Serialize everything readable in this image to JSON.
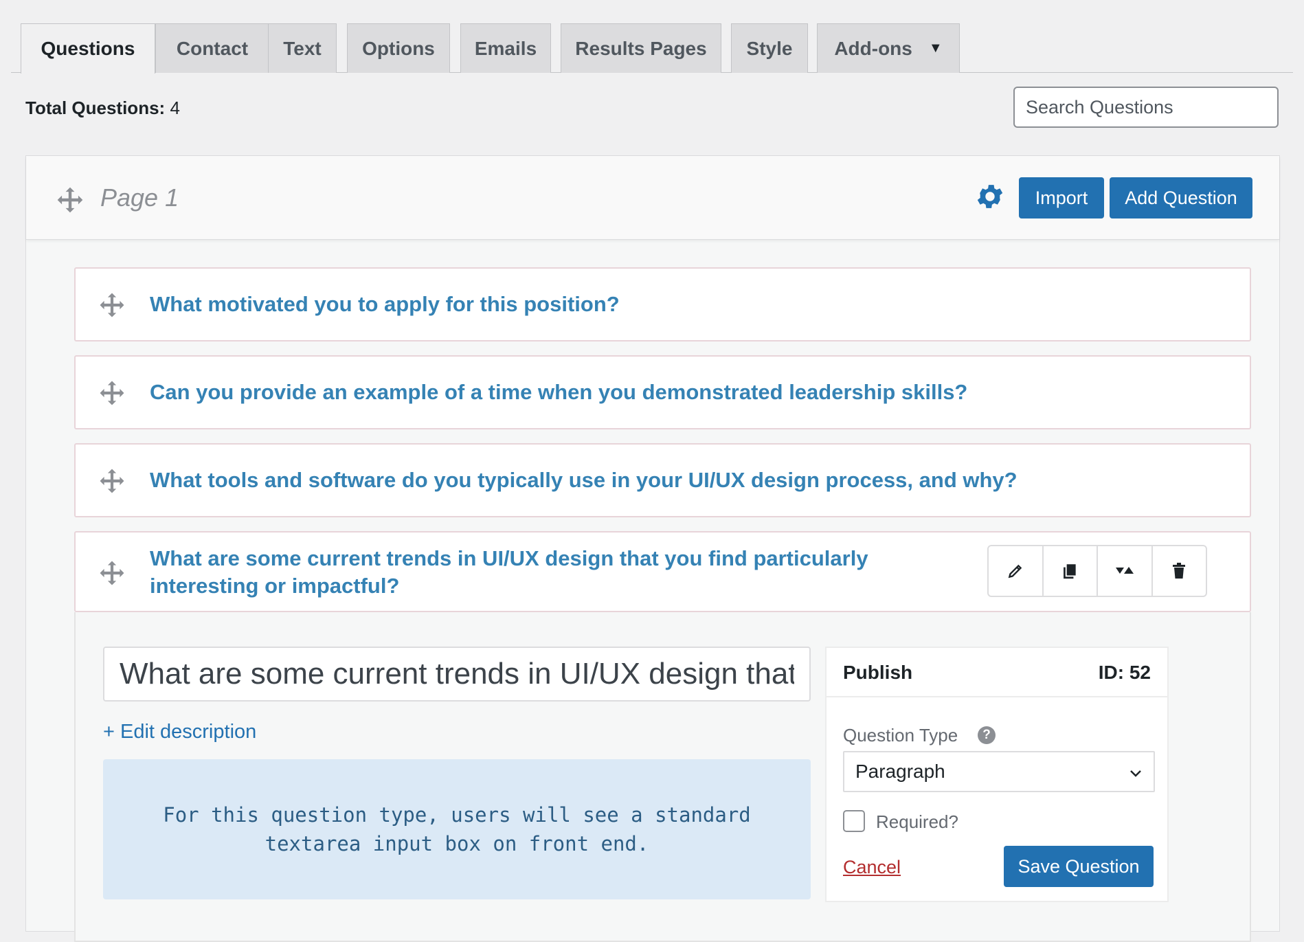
{
  "tabs": [
    {
      "label": "Questions"
    },
    {
      "label": "Contact"
    },
    {
      "label": "Text"
    },
    {
      "label": "Options"
    },
    {
      "label": "Emails"
    },
    {
      "label": "Results Pages"
    },
    {
      "label": "Style"
    },
    {
      "label": "Add-ons"
    }
  ],
  "summary": {
    "total_label": "Total Questions:",
    "total_value": "4"
  },
  "search": {
    "placeholder": "Search Questions"
  },
  "page": {
    "title": "Page 1",
    "import_label": "Import",
    "add_question_label": "Add Question"
  },
  "questions": [
    {
      "text": "What motivated you to apply for this position?"
    },
    {
      "text": "Can you provide an example of a time when you demonstrated leadership skills?"
    },
    {
      "text": "What tools and software do you typically use in your UI/UX design process, and why?"
    },
    {
      "text": "What are some current trends in UI/UX design that you find particularly interesting or impactful?"
    }
  ],
  "question_actions": [
    "pencil-icon",
    "duplicate-icon",
    "move-up-down-icon",
    "trash-icon"
  ],
  "editor": {
    "question_value": "What are some current trends in UI/UX design that you find particularly interesting or impactful?",
    "edit_description_label": "+ Edit description",
    "info_text": "For this question type, users will see a standard textarea input box on front end."
  },
  "publish": {
    "title": "Publish",
    "id_label": "ID: 52",
    "question_type_label": "Question Type",
    "question_type_value": "Paragraph",
    "required_label": "Required?",
    "required_checked": false,
    "cancel_label": "Cancel",
    "save_label": "Save Question"
  },
  "colors": {
    "accent": "#2271b1",
    "question_text": "#3582b4",
    "info_bg": "#dbe9f6",
    "cancel": "#b32d2e"
  }
}
